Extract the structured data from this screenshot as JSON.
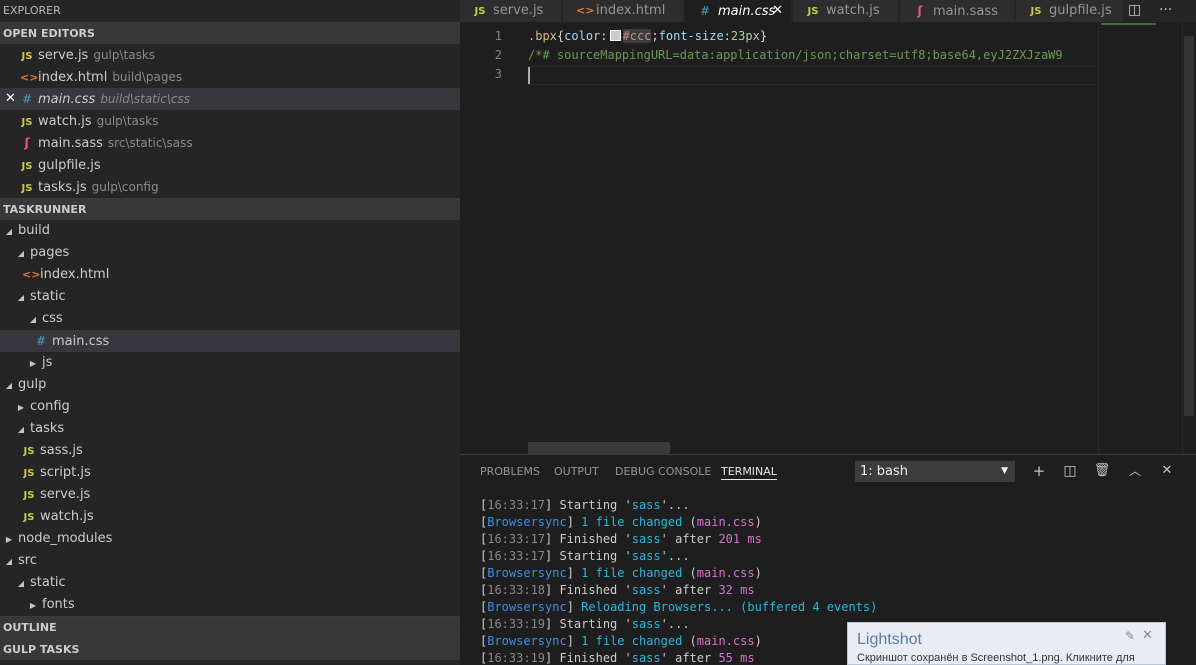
{
  "sidebar": {
    "title": "EXPLORER",
    "open_editors": {
      "header": "OPEN EDITORS",
      "items": [
        {
          "name": "serve.js",
          "path": "gulp\\tasks"
        },
        {
          "name": "index.html",
          "path": "build\\pages"
        },
        {
          "name": "main.css",
          "path": "build\\static\\css"
        },
        {
          "name": "watch.js",
          "path": "gulp\\tasks"
        },
        {
          "name": "main.sass",
          "path": "src\\static\\sass"
        },
        {
          "name": "gulpfile.js",
          "path": ""
        },
        {
          "name": "tasks.js",
          "path": "gulp\\config"
        }
      ]
    },
    "project": {
      "header": "TASKRUNNER",
      "tree": [
        "build",
        "pages",
        "index.html",
        "static",
        "css",
        "main.css",
        "js",
        "gulp",
        "config",
        "tasks",
        "sass.js",
        "script.js",
        "serve.js",
        "watch.js",
        "node_modules",
        "src",
        "static",
        "fonts"
      ]
    },
    "outline_header": "OUTLINE",
    "gulp_tasks_header": "GULP TASKS"
  },
  "tabs": [
    {
      "label": "serve.js"
    },
    {
      "label": "index.html"
    },
    {
      "label": "main.css"
    },
    {
      "label": "watch.js"
    },
    {
      "label": "main.sass"
    },
    {
      "label": "gulpfile.js"
    }
  ],
  "editor": {
    "line_numbers": [
      "1",
      "2",
      "3"
    ],
    "line1": {
      "selector": ".bpx",
      "open": "{",
      "prop1": "color",
      "colon": ":",
      "value1": "#ccc",
      "semi": ";",
      "prop2": "font-size",
      "value2": "23px",
      "close": "}"
    },
    "line2": "/*# sourceMappingURL=data:application/json;charset=utf8;base64,eyJ2ZXJzaW9",
    "swatch_color": "#cccccc"
  },
  "panel": {
    "tabs": [
      "PROBLEMS",
      "OUTPUT",
      "DEBUG CONSOLE",
      "TERMINAL"
    ],
    "terminal_select": "1: bash",
    "lines": [
      {
        "type": "task",
        "time": "16:33:17",
        "verb": "Starting",
        "task": "sass",
        "tail": "..."
      },
      {
        "type": "bs",
        "prefix": "Browsersync",
        "text": "1 file changed",
        "file": "main.css"
      },
      {
        "type": "finish",
        "time": "16:33:17",
        "verb": "Finished",
        "task": "sass",
        "after": "after",
        "ms": "201 ms"
      },
      {
        "type": "task",
        "time": "16:33:17",
        "verb": "Starting",
        "task": "sass",
        "tail": "..."
      },
      {
        "type": "bs",
        "prefix": "Browsersync",
        "text": "1 file changed",
        "file": "main.css"
      },
      {
        "type": "finish",
        "time": "16:33:18",
        "verb": "Finished",
        "task": "sass",
        "after": "after",
        "ms": "32 ms"
      },
      {
        "type": "reload",
        "prefix": "Browsersync",
        "text": "Reloading Browsers... (buffered 4 events)"
      },
      {
        "type": "task",
        "time": "16:33:19",
        "verb": "Starting",
        "task": "sass",
        "tail": "..."
      },
      {
        "type": "bs",
        "prefix": "Browsersync",
        "text": "1 file changed",
        "file": "main.css"
      },
      {
        "type": "finish",
        "time": "16:33:19",
        "verb": "Finished",
        "task": "sass",
        "after": "after",
        "ms": "55 ms"
      }
    ]
  },
  "toast": {
    "title": "Lightshot",
    "message": "Скриншот сохранён в Screenshot_1.png. Кликните для"
  }
}
